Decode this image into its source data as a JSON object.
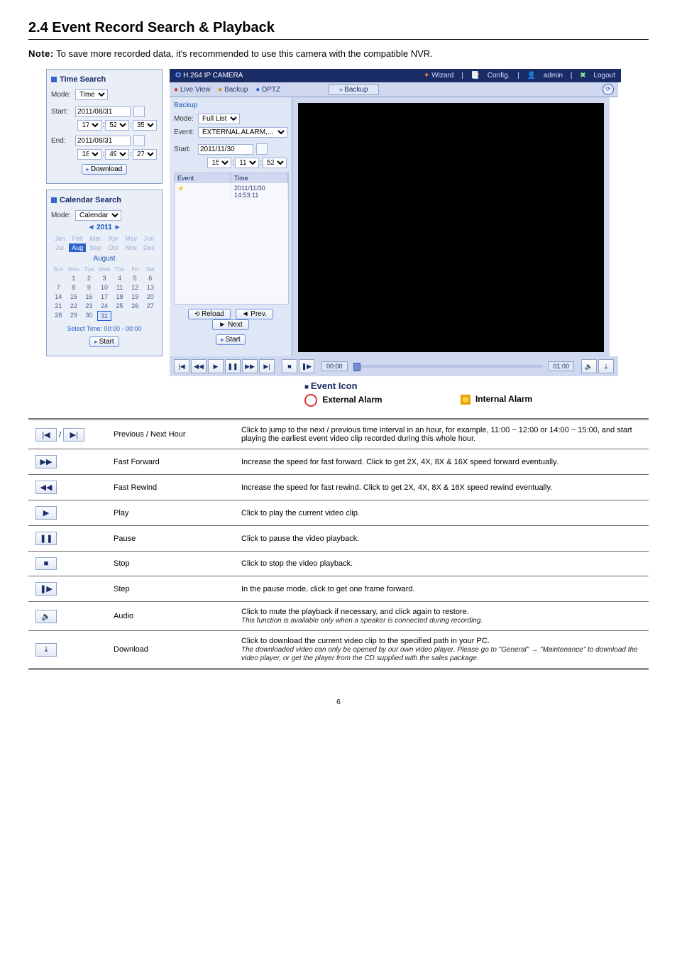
{
  "page": {
    "heading": "2.4 Event Record Search & Playback",
    "note_label": "Note:",
    "note_text": "To save more recorded data, it's recommended to use this camera with the compatible NVR.",
    "page_number": "6"
  },
  "timesearch": {
    "title": "Time Search",
    "mode_label": "Mode:",
    "mode_value": "Time",
    "start_label": "Start:",
    "start_date": "2011/08/31",
    "start_hh": "17",
    "start_mm": "52",
    "start_ss": "35",
    "end_label": "End:",
    "end_date": "2011/08/31",
    "end_hh": "18",
    "end_mm": "49",
    "end_ss": "27",
    "download": "Download"
  },
  "calsearch": {
    "title": "Calendar Search",
    "mode_label": "Mode:",
    "mode_value": "Calendar",
    "year": "2011",
    "months": [
      "Jan",
      "Feb",
      "Mar",
      "Apr",
      "May",
      "Jun",
      "Jul",
      "Aug",
      "Sep",
      "Oct",
      "Nov",
      "Dec"
    ],
    "active_month_index": 7,
    "month_label": "August",
    "dow": [
      "Sun",
      "Mon",
      "Tue",
      "Wed",
      "Thu",
      "Fri",
      "Sat"
    ],
    "weeks": [
      [
        "",
        "1",
        "2",
        "3",
        "4",
        "5",
        "6"
      ],
      [
        "7",
        "8",
        "9",
        "10",
        "11",
        "12",
        "13"
      ],
      [
        "14",
        "15",
        "16",
        "17",
        "18",
        "19",
        "20"
      ],
      [
        "21",
        "22",
        "23",
        "24",
        "25",
        "26",
        "27"
      ],
      [
        "28",
        "29",
        "30",
        "31",
        "",
        "",
        ""
      ]
    ],
    "selected_day": "31",
    "select_time": "Select Time: 00:00 - 00:00",
    "start": "Start"
  },
  "cam": {
    "brand": "H.264 IP CAMERA",
    "links": {
      "wizard": "Wizard",
      "config": "Config.",
      "admin": "admin",
      "logout": "Logout"
    },
    "tabs": {
      "live": "Live View",
      "backup": "Backup",
      "dptz": "DPTZ",
      "tab_active": "Backup"
    },
    "backup": {
      "title": "Backup",
      "mode_label": "Mode:",
      "mode_value": "Full List",
      "event_label": "Event:",
      "event_value": "EXTERNAL ALARM,...",
      "start_label": "Start:",
      "start_date": "2011/11/30",
      "start_hh": "15",
      "start_mm": "11",
      "start_ss": "52",
      "col_event": "Event",
      "col_time": "Time",
      "row_time": "2011/11/30 14:53:11",
      "reload": "Reload",
      "prev": "Prev.",
      "next": "Next",
      "start": "Start"
    },
    "player": {
      "t0": "00:00",
      "t1": "01:00"
    }
  },
  "legend": {
    "title": "Event Icon",
    "ext": "External Alarm",
    "int": "Internal Alarm"
  },
  "table": {
    "rows": [
      {
        "icon_html": "|◀   ▶|",
        "name": "Previous / Next Hour",
        "desc": "Click to jump to the next / previous time interval in an hour, for example, 11:00 ~ 12:00 or 14:00 ~ 15:00, and start playing the earliest event video clip recorded during this whole hour."
      },
      {
        "icon_html": "▶▶",
        "name": "Fast Forward",
        "desc": "Increase the speed for fast forward. Click to get 2X, 4X, 8X & 16X speed forward eventually."
      },
      {
        "icon_html": "◀◀",
        "name": "Fast Rewind",
        "desc": "Increase the speed for fast rewind. Click to get 2X, 4X, 8X & 16X speed rewind eventually."
      },
      {
        "icon_html": "▶",
        "name": "Play",
        "desc": "Click to play the current video clip."
      },
      {
        "icon_html": "❚❚",
        "name": "Pause",
        "desc": "Click to pause the video playback."
      },
      {
        "icon_html": "■",
        "name": "Stop",
        "desc": "Click to stop the video playback."
      },
      {
        "icon_html": "❚▶",
        "name": "Step",
        "desc": "In the pause mode, click to get one frame forward."
      },
      {
        "icon_html": "🔈",
        "name": "Audio",
        "desc": "Click to mute the playback if necessary, and click again to restore.",
        "desc_em": "This function is available only when a speaker is connected during recording."
      },
      {
        "icon_html": "⤓",
        "name": "Download",
        "desc": "Click to download the current video clip to the specified path in your PC.",
        "desc_em": "The downloaded video can only be opened by our own video player. Please go to \"General\" → \"Maintenance\" to download the video player, or get the player from the CD supplied with the sales package."
      }
    ]
  }
}
